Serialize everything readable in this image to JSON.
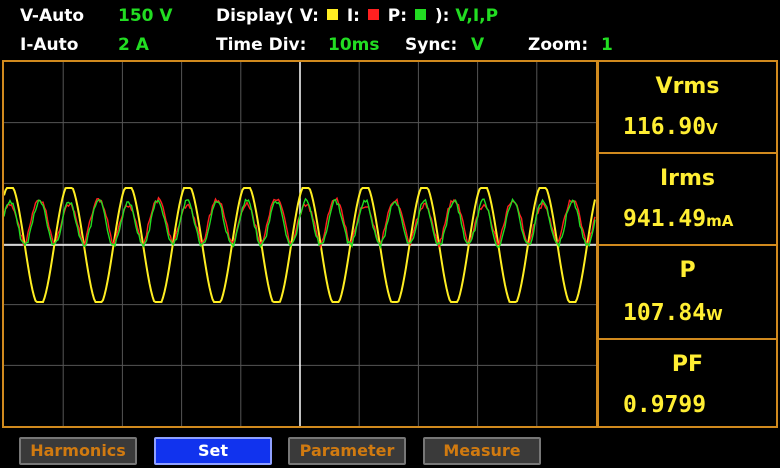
{
  "header": {
    "v_mode": "V-Auto",
    "v_range": "150 V",
    "display_label": "Display( V:",
    "display_i": "I:",
    "display_p": "P:",
    "display_close": "):",
    "display_value": "V,I,P",
    "i_mode": "I-Auto",
    "i_range": "2 A",
    "timediv_label": "Time  Div:",
    "timediv_value": "10ms",
    "sync_label": "Sync:",
    "sync_value": "V",
    "zoom_label": "Zoom:",
    "zoom_value": "1"
  },
  "colors": {
    "voltage": "#ffee22",
    "current": "#ff2020",
    "power": "#22dd22",
    "frame": "#d08a1e"
  },
  "measurements": [
    {
      "label": "Vrms",
      "value": "116.90",
      "unit": "V"
    },
    {
      "label": "Irms",
      "value": "941.49",
      "unit": "mA"
    },
    {
      "label": "P",
      "value": "107.84",
      "unit": "W"
    },
    {
      "label": "PF",
      "value": "0.9799",
      "unit": ""
    }
  ],
  "softkeys": [
    {
      "label": "Harmonics"
    },
    {
      "label": "Set"
    },
    {
      "label": "Parameter"
    },
    {
      "label": "Measure"
    }
  ],
  "chart_data": {
    "type": "line",
    "waveform_cycles_shown": 10,
    "series": [
      {
        "name": "V"
      },
      {
        "name": "I"
      },
      {
        "name": "P"
      }
    ]
  }
}
